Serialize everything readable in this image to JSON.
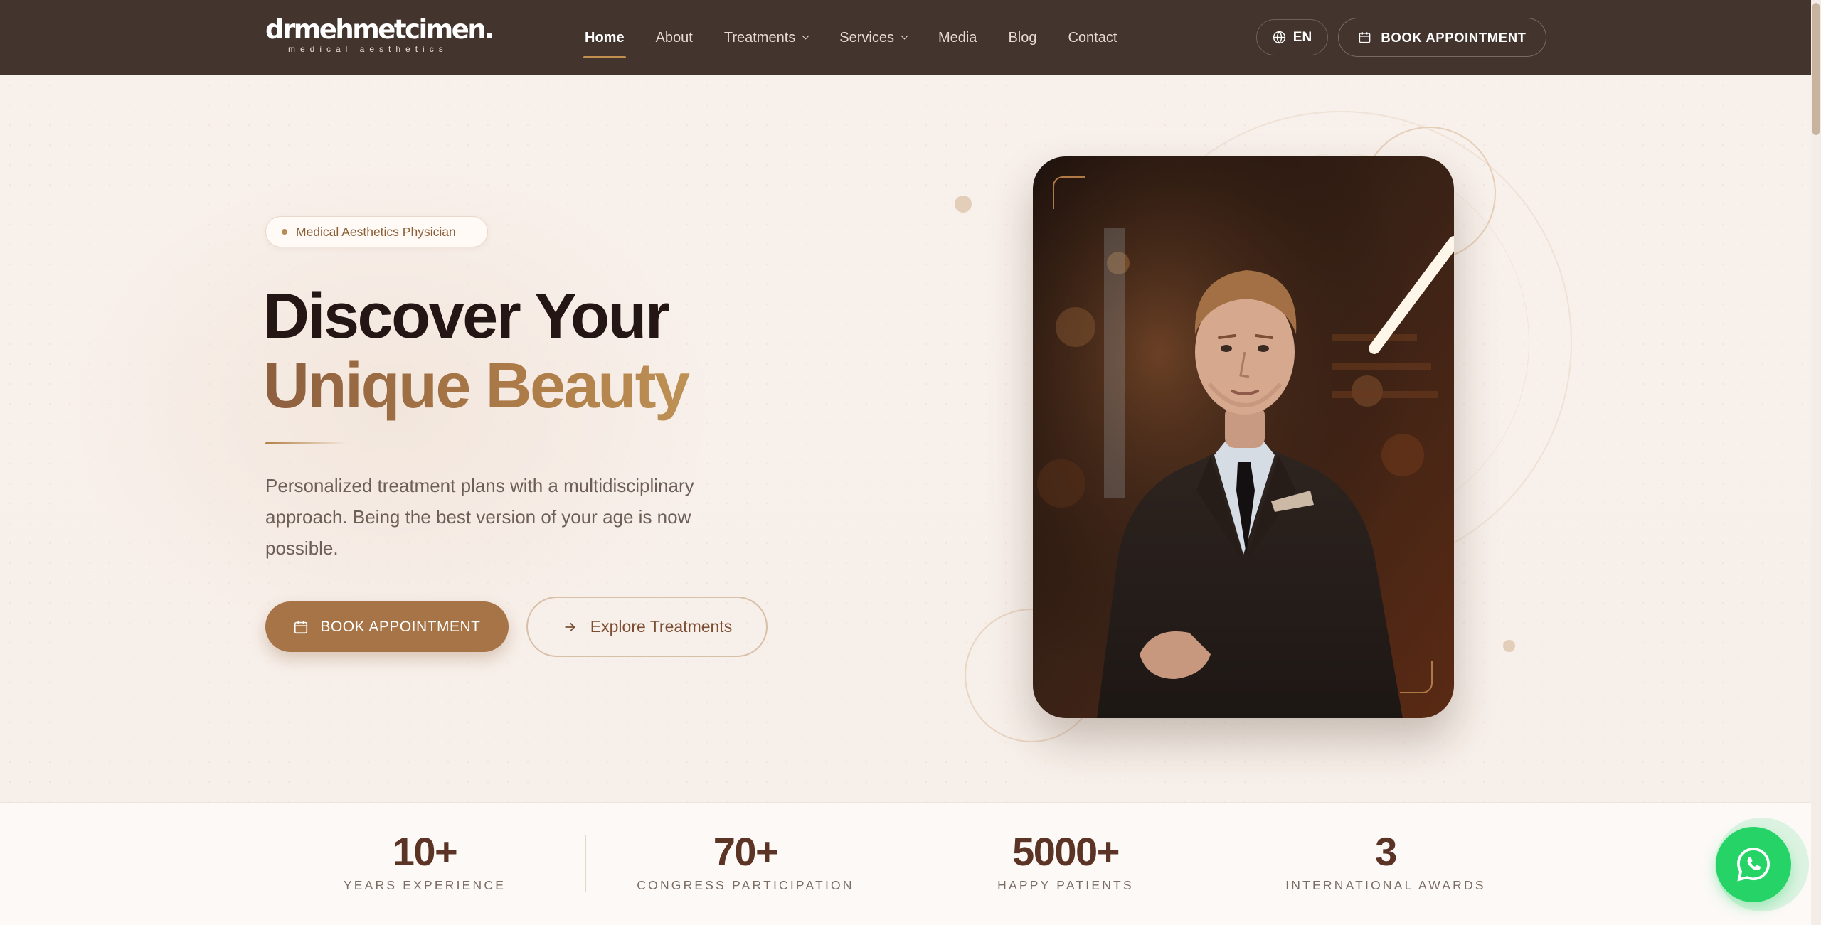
{
  "brand": {
    "logo_main": "drmehmetcimen.",
    "logo_sub": "medical aesthetics"
  },
  "nav": {
    "items": [
      {
        "label": "Home",
        "active": true,
        "dropdown": false
      },
      {
        "label": "About",
        "active": false,
        "dropdown": false
      },
      {
        "label": "Treatments",
        "active": false,
        "dropdown": true
      },
      {
        "label": "Services",
        "active": false,
        "dropdown": true
      },
      {
        "label": "Media",
        "active": false,
        "dropdown": false
      },
      {
        "label": "Blog",
        "active": false,
        "dropdown": false
      },
      {
        "label": "Contact",
        "active": false,
        "dropdown": false
      }
    ],
    "language": "EN",
    "book_label": "BOOK APPOINTMENT",
    "globe_icon": "globe-icon",
    "calendar_icon": "calendar-icon"
  },
  "hero": {
    "badge": "Medical Aesthetics Physician",
    "title_line1": "Discover Your",
    "title_line2": "Unique Beauty",
    "description": "Personalized treatment plans with a multidisciplinary approach. Being the best version of your age is now possible.",
    "primary_button": "BOOK APPOINTMENT",
    "secondary_button": "Explore Treatments"
  },
  "stats": [
    {
      "value": "10+",
      "label": "YEARS EXPERIENCE"
    },
    {
      "value": "70+",
      "label": "CONGRESS PARTICIPATION"
    },
    {
      "value": "5000+",
      "label": "HAPPY PATIENTS"
    },
    {
      "value": "3",
      "label": "INTERNATIONAL AWARDS"
    }
  ],
  "colors": {
    "nav_bg": "#43352d",
    "accent": "#a67446",
    "gold": "#c28f4e",
    "hero_bg": "#f8f1ec",
    "whatsapp": "#25d366"
  },
  "whatsapp_icon": "whatsapp-icon"
}
